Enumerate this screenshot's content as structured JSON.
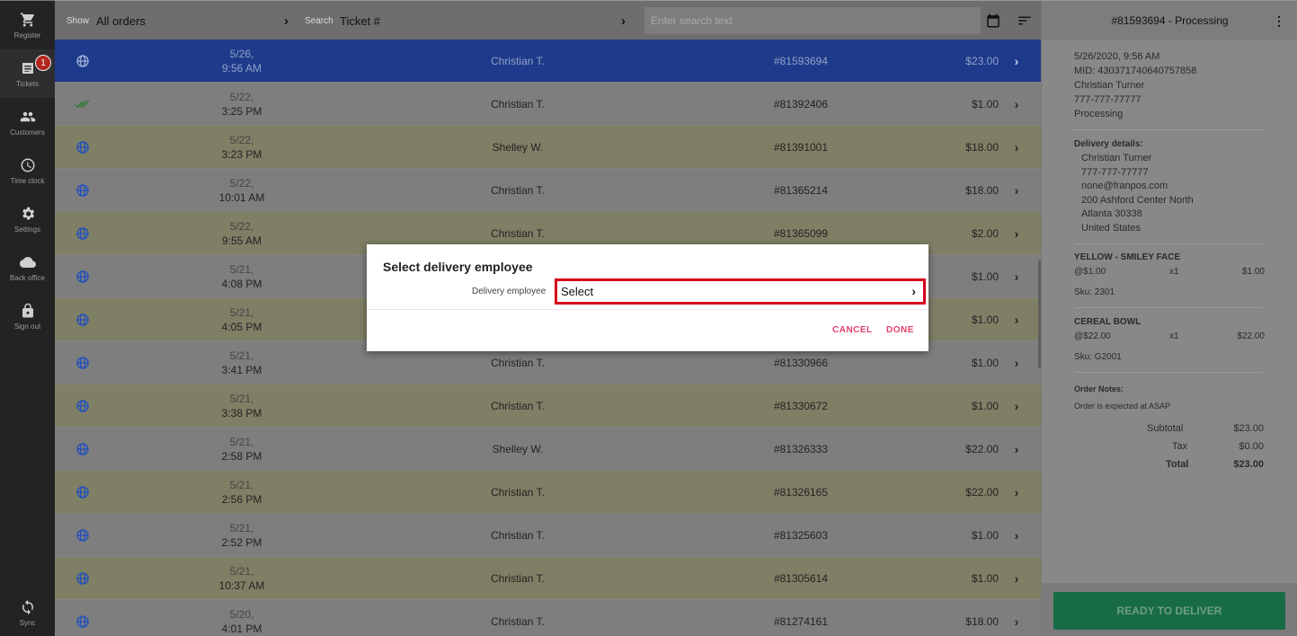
{
  "sidebar": {
    "items": [
      {
        "label": "Register",
        "icon": "cart-icon"
      },
      {
        "label": "Tickets",
        "icon": "receipt-icon",
        "badge": "1"
      },
      {
        "label": "Customers",
        "icon": "people-icon"
      },
      {
        "label": "Time clock",
        "icon": "clock-icon"
      },
      {
        "label": "Settings",
        "icon": "gear-icon"
      },
      {
        "label": "Back office",
        "icon": "cloud-icon"
      },
      {
        "label": "Sign out",
        "icon": "lock-icon"
      },
      {
        "label": "Sync",
        "icon": "sync-icon"
      }
    ]
  },
  "topbar": {
    "show_label": "Show",
    "show_value": "All orders",
    "search_label": "Search",
    "search_value": "Ticket #",
    "search_placeholder": "Enter search text"
  },
  "tickets": [
    {
      "date": "5/26,",
      "time": "9:56 AM",
      "name": "Christian T.",
      "ticket": "#81593694",
      "total": "$23.00",
      "status": "globe-icon",
      "selected": true
    },
    {
      "date": "5/22,",
      "time": "3:25 PM",
      "name": "Christian T.",
      "ticket": "#81392406",
      "total": "$1.00",
      "status": "double-check-icon"
    },
    {
      "date": "5/22,",
      "time": "3:23 PM",
      "name": "Shelley W.",
      "ticket": "#81391001",
      "total": "$18.00",
      "status": "globe-icon"
    },
    {
      "date": "5/22,",
      "time": "10:01 AM",
      "name": "Christian T.",
      "ticket": "#81365214",
      "total": "$18.00",
      "status": "globe-icon"
    },
    {
      "date": "5/22,",
      "time": "9:55 AM",
      "name": "Christian T.",
      "ticket": "#81365099",
      "total": "$2.00",
      "status": "globe-icon"
    },
    {
      "date": "5/21,",
      "time": "4:08 PM",
      "name": "",
      "ticket": "",
      "total": "$1.00",
      "status": "globe-icon"
    },
    {
      "date": "5/21,",
      "time": "4:05 PM",
      "name": "",
      "ticket": "",
      "total": "$1.00",
      "status": "globe-icon"
    },
    {
      "date": "5/21,",
      "time": "3:41 PM",
      "name": "Christian T.",
      "ticket": "#81330966",
      "total": "$1.00",
      "status": "globe-icon"
    },
    {
      "date": "5/21,",
      "time": "3:38 PM",
      "name": "Christian T.",
      "ticket": "#81330672",
      "total": "$1.00",
      "status": "globe-icon"
    },
    {
      "date": "5/21,",
      "time": "2:58 PM",
      "name": "Shelley W.",
      "ticket": "#81326333",
      "total": "$22.00",
      "status": "globe-icon"
    },
    {
      "date": "5/21,",
      "time": "2:56 PM",
      "name": "Christian T.",
      "ticket": "#81326165",
      "total": "$22.00",
      "status": "globe-icon"
    },
    {
      "date": "5/21,",
      "time": "2:52 PM",
      "name": "Christian T.",
      "ticket": "#81325603",
      "total": "$1.00",
      "status": "globe-icon"
    },
    {
      "date": "5/21,",
      "time": "10:37 AM",
      "name": "Christian T.",
      "ticket": "#81305614",
      "total": "$1.00",
      "status": "globe-icon"
    },
    {
      "date": "5/20,",
      "time": "4:01 PM",
      "name": "Christian T.",
      "ticket": "#81274161",
      "total": "$18.00",
      "status": "globe-icon"
    }
  ],
  "detail": {
    "header": "#81593694 - Processing",
    "datetime": "5/26/2020, 9:56 AM",
    "mid": "MID: 430371740640757858",
    "customer": "Christian Turner",
    "phone": "777-777-77777",
    "status": "Processing",
    "delivery_title": "Delivery details:",
    "delivery_lines": [
      "Christian Turner",
      "777-777-77777",
      "none@franpos.com",
      "200 Ashford Center North",
      "Atlanta 30338",
      "United States"
    ],
    "items": [
      {
        "name": "YELLOW - SMILEY FACE",
        "price": "@$1.00",
        "qty": "x1",
        "amount": "$1.00",
        "sku": "Sku: 2301"
      },
      {
        "name": "CEREAL BOWL",
        "price": "@$22.00",
        "qty": "x1",
        "amount": "$22.00",
        "sku": "Sku: G2001"
      }
    ],
    "notes_title": "Order Notes:",
    "notes": "Order is expected at ASAP",
    "subtotal_label": "Subtotal",
    "subtotal": "$23.00",
    "tax_label": "Tax",
    "tax": "$0.00",
    "total_label": "Total",
    "total": "$23.00",
    "ready_button": "READY TO DELIVER"
  },
  "dialog": {
    "title": "Select delivery employee",
    "field_label": "Delivery employee",
    "field_value": "Select",
    "cancel": "CANCEL",
    "done": "DONE"
  },
  "colors": {
    "selected_row": "#1e3a8a",
    "highlight_border": "#d6001c",
    "dialog_button": "#e4406b",
    "ready_button": "#176c46",
    "badge": "#b3261e"
  }
}
